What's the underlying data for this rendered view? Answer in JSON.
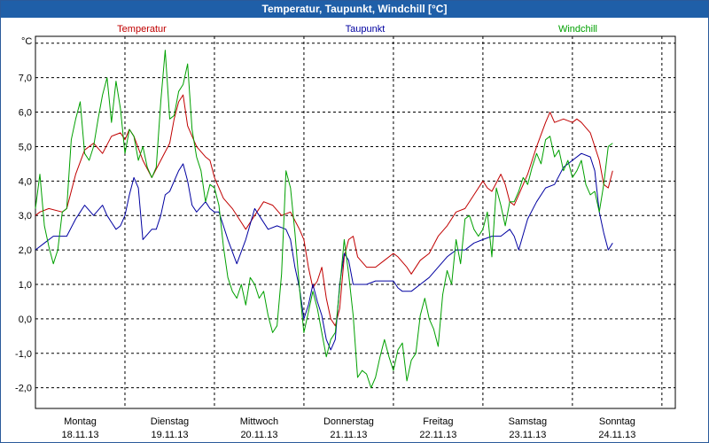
{
  "window": {
    "title": "Temperatur, Taupunkt, Windchill [°C]"
  },
  "chart_data": {
    "type": "line",
    "title": "Temperatur, Taupunkt, Windchill [°C]",
    "ylabel": "°C",
    "ylim": [
      -2.6,
      8.2
    ],
    "xlim": [
      0,
      7.15
    ],
    "yticks": [
      {
        "value": 7,
        "label": "7,0"
      },
      {
        "value": 6,
        "label": "6,0"
      },
      {
        "value": 5,
        "label": "5,0"
      },
      {
        "value": 4,
        "label": "4,0"
      },
      {
        "value": 3,
        "label": "3,0"
      },
      {
        "value": 2,
        "label": "2,0"
      },
      {
        "value": 1,
        "label": "1,0"
      },
      {
        "value": 0,
        "label": "0,0"
      },
      {
        "value": -1,
        "label": "-1,0"
      },
      {
        "value": -2,
        "label": "-2,0"
      }
    ],
    "days": [
      {
        "day": "Montag",
        "date": "18.11.13"
      },
      {
        "day": "Dienstag",
        "date": "19.11.13"
      },
      {
        "day": "Mittwoch",
        "date": "20.11.13"
      },
      {
        "day": "Donnerstag",
        "date": "21.11.13"
      },
      {
        "day": "Freitag",
        "date": "22.11.13"
      },
      {
        "day": "Samstag",
        "date": "23.11.13"
      },
      {
        "day": "Sonntag",
        "date": "24.11.13"
      }
    ],
    "grid": true,
    "legend_placement": "top",
    "series": [
      {
        "name": "Temperatur",
        "color": "#c00000",
        "points": [
          [
            0,
            3.0
          ],
          [
            0.05,
            3.1
          ],
          [
            0.15,
            3.2
          ],
          [
            0.3,
            3.1
          ],
          [
            0.35,
            3.2
          ],
          [
            0.45,
            4.2
          ],
          [
            0.55,
            4.9
          ],
          [
            0.65,
            5.1
          ],
          [
            0.75,
            4.8
          ],
          [
            0.85,
            5.3
          ],
          [
            0.95,
            5.4
          ],
          [
            1.0,
            5.2
          ],
          [
            1.05,
            5.5
          ],
          [
            1.1,
            5.3
          ],
          [
            1.2,
            4.6
          ],
          [
            1.3,
            4.1
          ],
          [
            1.4,
            4.6
          ],
          [
            1.5,
            5.1
          ],
          [
            1.55,
            5.8
          ],
          [
            1.6,
            6.3
          ],
          [
            1.65,
            6.5
          ],
          [
            1.7,
            5.6
          ],
          [
            1.8,
            5.0
          ],
          [
            1.9,
            4.7
          ],
          [
            1.95,
            4.6
          ],
          [
            2.0,
            4.1
          ],
          [
            2.1,
            3.5
          ],
          [
            2.2,
            3.2
          ],
          [
            2.3,
            2.8
          ],
          [
            2.35,
            2.6
          ],
          [
            2.45,
            3.0
          ],
          [
            2.55,
            3.4
          ],
          [
            2.65,
            3.3
          ],
          [
            2.75,
            3.0
          ],
          [
            2.85,
            3.1
          ],
          [
            2.95,
            2.6
          ],
          [
            3.0,
            2.3
          ],
          [
            3.05,
            1.5
          ],
          [
            3.1,
            0.9
          ],
          [
            3.15,
            1.1
          ],
          [
            3.2,
            1.5
          ],
          [
            3.25,
            0.6
          ],
          [
            3.3,
            0.0
          ],
          [
            3.35,
            -0.2
          ],
          [
            3.4,
            0.3
          ],
          [
            3.45,
            1.8
          ],
          [
            3.5,
            2.3
          ],
          [
            3.55,
            2.4
          ],
          [
            3.6,
            1.8
          ],
          [
            3.7,
            1.5
          ],
          [
            3.8,
            1.5
          ],
          [
            3.9,
            1.7
          ],
          [
            4.0,
            1.9
          ],
          [
            4.05,
            1.8
          ],
          [
            4.15,
            1.5
          ],
          [
            4.2,
            1.3
          ],
          [
            4.3,
            1.7
          ],
          [
            4.4,
            1.9
          ],
          [
            4.5,
            2.4
          ],
          [
            4.6,
            2.7
          ],
          [
            4.7,
            3.1
          ],
          [
            4.8,
            3.2
          ],
          [
            4.9,
            3.6
          ],
          [
            5.0,
            4.0
          ],
          [
            5.05,
            3.8
          ],
          [
            5.1,
            3.7
          ],
          [
            5.2,
            4.2
          ],
          [
            5.25,
            3.9
          ],
          [
            5.3,
            3.4
          ],
          [
            5.35,
            3.3
          ],
          [
            5.4,
            3.6
          ],
          [
            5.5,
            4.2
          ],
          [
            5.6,
            5.0
          ],
          [
            5.7,
            5.7
          ],
          [
            5.75,
            6.0
          ],
          [
            5.8,
            5.7
          ],
          [
            5.9,
            5.8
          ],
          [
            6.0,
            5.7
          ],
          [
            6.05,
            5.8
          ],
          [
            6.1,
            5.7
          ],
          [
            6.2,
            5.4
          ],
          [
            6.3,
            4.6
          ],
          [
            6.35,
            3.9
          ],
          [
            6.4,
            3.8
          ],
          [
            6.45,
            4.3
          ]
        ]
      },
      {
        "name": "Taupunkt",
        "color": "#0000a0",
        "points": [
          [
            0,
            2.0
          ],
          [
            0.1,
            2.2
          ],
          [
            0.2,
            2.4
          ],
          [
            0.35,
            2.4
          ],
          [
            0.45,
            2.9
          ],
          [
            0.5,
            3.1
          ],
          [
            0.55,
            3.3
          ],
          [
            0.65,
            3.0
          ],
          [
            0.75,
            3.3
          ],
          [
            0.8,
            3.0
          ],
          [
            0.85,
            2.8
          ],
          [
            0.9,
            2.6
          ],
          [
            0.95,
            2.7
          ],
          [
            1.0,
            3.0
          ],
          [
            1.05,
            3.6
          ],
          [
            1.1,
            4.1
          ],
          [
            1.15,
            3.8
          ],
          [
            1.2,
            2.3
          ],
          [
            1.3,
            2.6
          ],
          [
            1.35,
            2.6
          ],
          [
            1.4,
            3.0
          ],
          [
            1.45,
            3.6
          ],
          [
            1.5,
            3.7
          ],
          [
            1.6,
            4.3
          ],
          [
            1.65,
            4.5
          ],
          [
            1.7,
            4.0
          ],
          [
            1.75,
            3.3
          ],
          [
            1.8,
            3.1
          ],
          [
            1.9,
            3.4
          ],
          [
            1.95,
            3.2
          ],
          [
            2.0,
            3.1
          ],
          [
            2.05,
            3.1
          ],
          [
            2.1,
            2.7
          ],
          [
            2.15,
            2.3
          ],
          [
            2.25,
            1.6
          ],
          [
            2.35,
            2.3
          ],
          [
            2.45,
            3.2
          ],
          [
            2.5,
            3.0
          ],
          [
            2.6,
            2.6
          ],
          [
            2.7,
            2.7
          ],
          [
            2.8,
            2.6
          ],
          [
            2.85,
            2.3
          ],
          [
            2.9,
            1.5
          ],
          [
            2.95,
            0.9
          ],
          [
            3.0,
            0.0
          ],
          [
            3.05,
            0.4
          ],
          [
            3.1,
            1.0
          ],
          [
            3.15,
            0.5
          ],
          [
            3.2,
            0.1
          ],
          [
            3.25,
            -0.6
          ],
          [
            3.3,
            -0.9
          ],
          [
            3.35,
            -0.6
          ],
          [
            3.4,
            1.0
          ],
          [
            3.45,
            1.9
          ],
          [
            3.5,
            1.7
          ],
          [
            3.55,
            1.0
          ],
          [
            3.6,
            1.0
          ],
          [
            3.7,
            1.0
          ],
          [
            3.8,
            1.1
          ],
          [
            3.9,
            1.1
          ],
          [
            4.0,
            1.1
          ],
          [
            4.05,
            0.9
          ],
          [
            4.1,
            0.8
          ],
          [
            4.2,
            0.8
          ],
          [
            4.3,
            1.0
          ],
          [
            4.4,
            1.2
          ],
          [
            4.5,
            1.5
          ],
          [
            4.6,
            1.8
          ],
          [
            4.7,
            2.0
          ],
          [
            4.8,
            2.0
          ],
          [
            4.9,
            2.2
          ],
          [
            5.0,
            2.3
          ],
          [
            5.1,
            2.4
          ],
          [
            5.2,
            2.4
          ],
          [
            5.3,
            2.6
          ],
          [
            5.35,
            2.4
          ],
          [
            5.4,
            2.0
          ],
          [
            5.5,
            2.9
          ],
          [
            5.6,
            3.4
          ],
          [
            5.7,
            3.8
          ],
          [
            5.8,
            3.9
          ],
          [
            5.9,
            4.4
          ],
          [
            6.0,
            4.6
          ],
          [
            6.1,
            4.8
          ],
          [
            6.2,
            4.7
          ],
          [
            6.25,
            4.3
          ],
          [
            6.3,
            3.1
          ],
          [
            6.35,
            2.5
          ],
          [
            6.4,
            2.0
          ],
          [
            6.45,
            2.2
          ]
        ]
      },
      {
        "name": "Windchill",
        "color": "#00a000",
        "points": [
          [
            0,
            3.2
          ],
          [
            0.05,
            4.2
          ],
          [
            0.1,
            2.7
          ],
          [
            0.15,
            2.1
          ],
          [
            0.2,
            1.6
          ],
          [
            0.25,
            2.0
          ],
          [
            0.3,
            3.1
          ],
          [
            0.35,
            3.2
          ],
          [
            0.4,
            5.2
          ],
          [
            0.45,
            5.8
          ],
          [
            0.5,
            6.3
          ],
          [
            0.55,
            4.8
          ],
          [
            0.6,
            4.6
          ],
          [
            0.65,
            5.0
          ],
          [
            0.7,
            5.8
          ],
          [
            0.75,
            6.5
          ],
          [
            0.8,
            7.0
          ],
          [
            0.85,
            5.7
          ],
          [
            0.9,
            6.9
          ],
          [
            0.95,
            6.1
          ],
          [
            1.0,
            4.8
          ],
          [
            1.05,
            5.5
          ],
          [
            1.1,
            5.3
          ],
          [
            1.15,
            4.6
          ],
          [
            1.2,
            5.0
          ],
          [
            1.25,
            4.4
          ],
          [
            1.3,
            4.1
          ],
          [
            1.35,
            4.4
          ],
          [
            1.4,
            6.3
          ],
          [
            1.45,
            7.8
          ],
          [
            1.5,
            5.8
          ],
          [
            1.55,
            5.9
          ],
          [
            1.6,
            6.6
          ],
          [
            1.65,
            6.8
          ],
          [
            1.7,
            7.4
          ],
          [
            1.75,
            5.5
          ],
          [
            1.8,
            4.7
          ],
          [
            1.85,
            4.3
          ],
          [
            1.9,
            3.4
          ],
          [
            1.95,
            3.9
          ],
          [
            2.0,
            3.8
          ],
          [
            2.05,
            3.3
          ],
          [
            2.1,
            2.1
          ],
          [
            2.15,
            1.2
          ],
          [
            2.2,
            0.8
          ],
          [
            2.25,
            0.6
          ],
          [
            2.3,
            1.0
          ],
          [
            2.35,
            0.4
          ],
          [
            2.4,
            1.2
          ],
          [
            2.45,
            1.0
          ],
          [
            2.5,
            0.6
          ],
          [
            2.55,
            0.8
          ],
          [
            2.6,
            0.1
          ],
          [
            2.65,
            -0.4
          ],
          [
            2.7,
            -0.2
          ],
          [
            2.75,
            1.3
          ],
          [
            2.8,
            4.3
          ],
          [
            2.85,
            3.8
          ],
          [
            2.9,
            2.5
          ],
          [
            2.95,
            0.9
          ],
          [
            3.0,
            -0.4
          ],
          [
            3.05,
            0.2
          ],
          [
            3.1,
            0.8
          ],
          [
            3.15,
            0.3
          ],
          [
            3.2,
            -0.4
          ],
          [
            3.25,
            -1.1
          ],
          [
            3.3,
            -0.6
          ],
          [
            3.35,
            -0.4
          ],
          [
            3.4,
            0.9
          ],
          [
            3.45,
            2.3
          ],
          [
            3.5,
            1.3
          ],
          [
            3.55,
            0.1
          ],
          [
            3.6,
            -1.7
          ],
          [
            3.65,
            -1.5
          ],
          [
            3.7,
            -1.6
          ],
          [
            3.75,
            -2.0
          ],
          [
            3.8,
            -1.7
          ],
          [
            3.85,
            -1.1
          ],
          [
            3.9,
            -0.6
          ],
          [
            3.95,
            -1.1
          ],
          [
            4.0,
            -1.5
          ],
          [
            4.05,
            -0.9
          ],
          [
            4.1,
            -0.7
          ],
          [
            4.15,
            -1.8
          ],
          [
            4.2,
            -1.2
          ],
          [
            4.25,
            -1.0
          ],
          [
            4.3,
            0.1
          ],
          [
            4.35,
            0.6
          ],
          [
            4.4,
            0.0
          ],
          [
            4.45,
            -0.3
          ],
          [
            4.5,
            -0.8
          ],
          [
            4.55,
            0.7
          ],
          [
            4.6,
            1.4
          ],
          [
            4.65,
            1.0
          ],
          [
            4.7,
            2.3
          ],
          [
            4.75,
            1.6
          ],
          [
            4.8,
            2.9
          ],
          [
            4.85,
            3.0
          ],
          [
            4.9,
            2.6
          ],
          [
            4.95,
            2.4
          ],
          [
            5.0,
            2.6
          ],
          [
            5.05,
            3.1
          ],
          [
            5.1,
            1.8
          ],
          [
            5.15,
            3.8
          ],
          [
            5.2,
            3.3
          ],
          [
            5.25,
            2.7
          ],
          [
            5.3,
            3.4
          ],
          [
            5.35,
            3.4
          ],
          [
            5.4,
            3.7
          ],
          [
            5.45,
            4.1
          ],
          [
            5.5,
            3.9
          ],
          [
            5.55,
            4.4
          ],
          [
            5.6,
            4.8
          ],
          [
            5.65,
            4.5
          ],
          [
            5.7,
            5.2
          ],
          [
            5.75,
            5.3
          ],
          [
            5.8,
            4.7
          ],
          [
            5.85,
            4.9
          ],
          [
            5.9,
            4.3
          ],
          [
            5.95,
            4.6
          ],
          [
            6.0,
            4.1
          ],
          [
            6.05,
            4.3
          ],
          [
            6.1,
            4.6
          ],
          [
            6.15,
            3.9
          ],
          [
            6.2,
            3.6
          ],
          [
            6.25,
            3.7
          ],
          [
            6.3,
            3.1
          ],
          [
            6.35,
            3.9
          ],
          [
            6.4,
            5.0
          ],
          [
            6.45,
            5.1
          ]
        ]
      }
    ]
  }
}
